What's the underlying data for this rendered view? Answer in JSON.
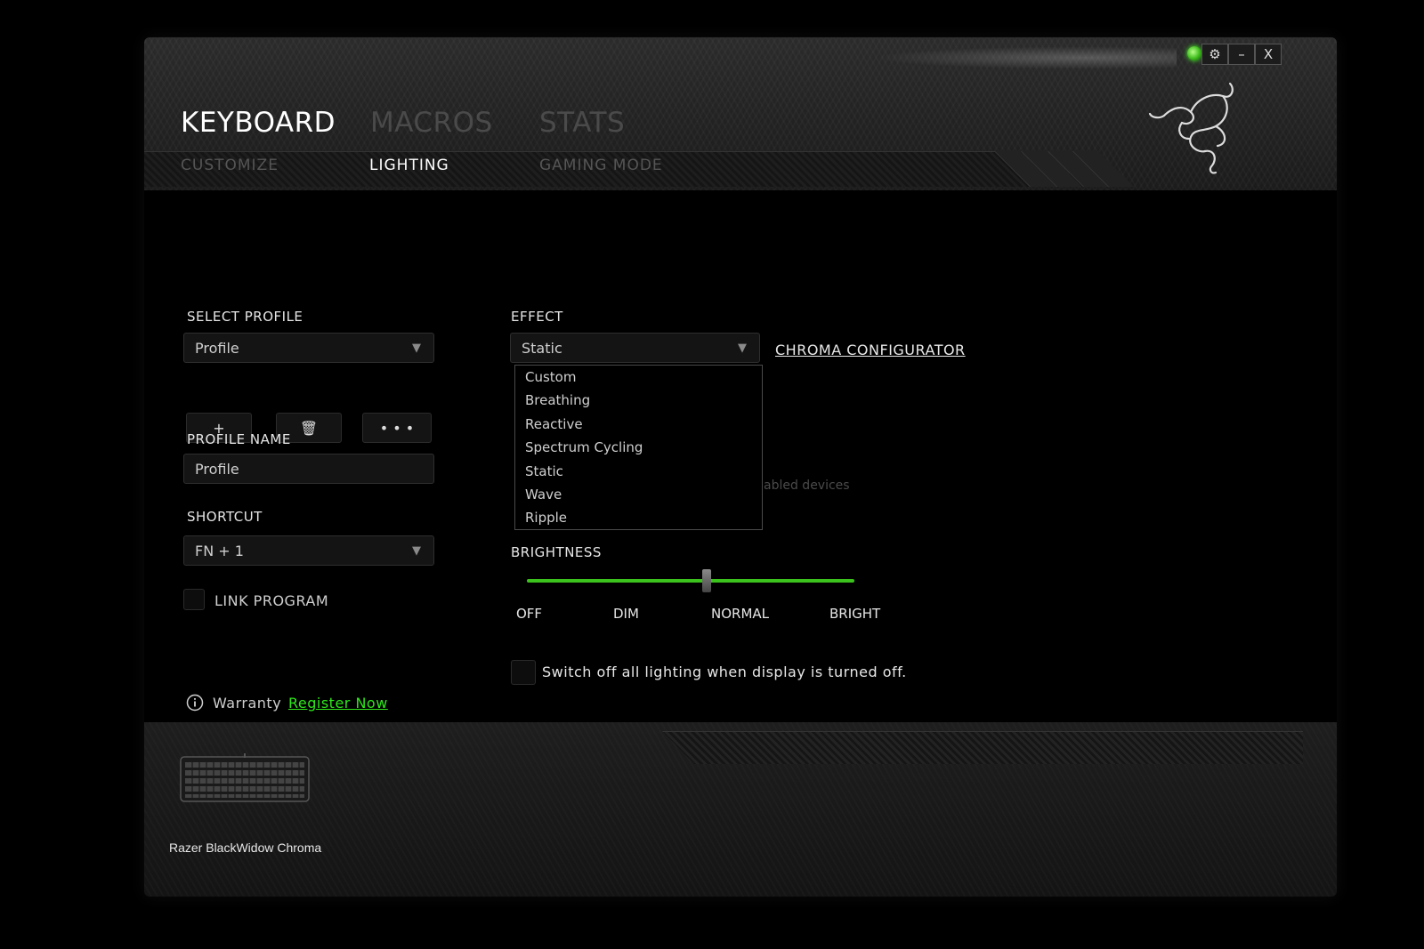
{
  "window": {
    "settings_icon": "gear-icon",
    "minimize_label": "–",
    "close_label": "X"
  },
  "main_tabs": [
    {
      "label": "KEYBOARD",
      "active": true
    },
    {
      "label": "MACROS",
      "active": false
    },
    {
      "label": "STATS",
      "active": false
    }
  ],
  "sub_tabs": [
    {
      "label": "CUSTOMIZE",
      "active": false
    },
    {
      "label": "LIGHTING",
      "active": true
    },
    {
      "label": "GAMING MODE",
      "active": false
    }
  ],
  "profile": {
    "select_label": "SELECT PROFILE",
    "selected": "Profile",
    "add_label": "+",
    "more_label": "• • •",
    "name_label": "PROFILE NAME",
    "name_value": "Profile",
    "shortcut_label": "SHORTCUT",
    "shortcut_value": "FN + 1",
    "link_program_label": "LINK PROGRAM"
  },
  "warranty": {
    "label": "Warranty",
    "link": "Register Now"
  },
  "effect": {
    "label": "EFFECT",
    "selected": "Static",
    "chroma_link": "CHROMA CONFIGURATOR",
    "options": [
      "Custom",
      "Breathing",
      "Reactive",
      "Spectrum Cycling",
      "Static",
      "Wave",
      "Ripple"
    ],
    "hidden_text": "abled devices"
  },
  "brightness": {
    "label": "BRIGHTNESS",
    "value_fraction": 0.55,
    "ticks": [
      "OFF",
      "DIM",
      "NORMAL",
      "BRIGHT"
    ]
  },
  "display_off": {
    "label": "Switch off all lighting when display is turned off."
  },
  "device": {
    "name": "Razer BlackWidow Chroma"
  },
  "colors": {
    "accent": "#44cc22",
    "link_green": "#2ee81a"
  }
}
